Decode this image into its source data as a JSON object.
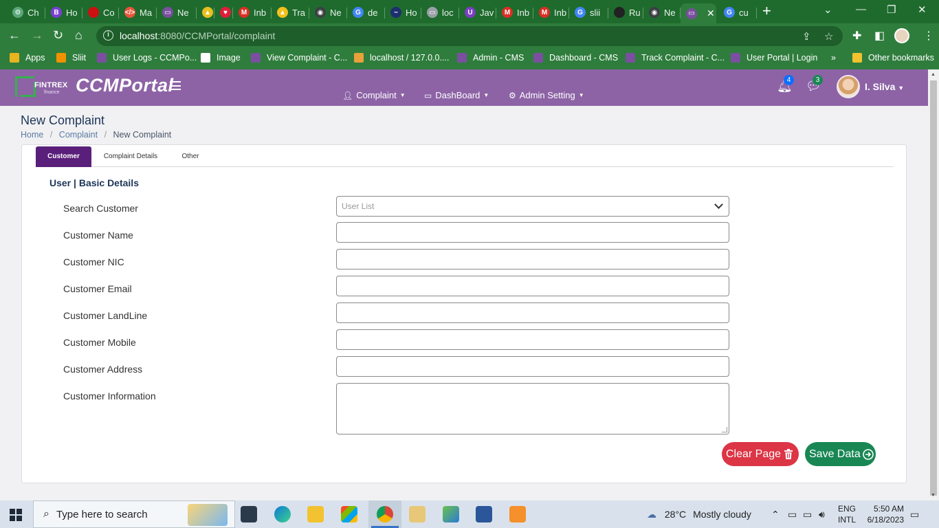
{
  "browser": {
    "tabs": [
      {
        "label": "Ch",
        "color": "#5aa77a",
        "glyph": "⚙"
      },
      {
        "label": "Ho",
        "color": "#7a3fd4",
        "glyph": "B"
      },
      {
        "label": "Co",
        "color": "#cc1111",
        "glyph": ""
      },
      {
        "label": "Ma",
        "color": "#e8553a",
        "glyph": "</>"
      },
      {
        "label": "Ne",
        "color": "#7a4fa0",
        "glyph": "▭"
      },
      {
        "label": "",
        "color": "#e8c01e",
        "glyph": "▲"
      },
      {
        "label": "",
        "color": "#e01e3a",
        "glyph": "♥"
      },
      {
        "label": "Inb",
        "color": "#d93025",
        "glyph": "M"
      },
      {
        "label": "Tra",
        "color": "#f2c01b",
        "glyph": "▲"
      },
      {
        "label": "Ne",
        "color": "#3c4043",
        "glyph": "◉"
      },
      {
        "label": "de",
        "color": "#4285f4",
        "glyph": "G"
      },
      {
        "label": "Ho",
        "color": "#1d2f6f",
        "glyph": "~"
      },
      {
        "label": "loc",
        "color": "#9aa0a6",
        "glyph": "▭"
      },
      {
        "label": "Jav",
        "color": "#7b3fc0",
        "glyph": "U"
      },
      {
        "label": "Inb",
        "color": "#d93025",
        "glyph": "M"
      },
      {
        "label": "Inb",
        "color": "#d93025",
        "glyph": "M"
      },
      {
        "label": "slii",
        "color": "#4285f4",
        "glyph": "G"
      },
      {
        "label": "Ru",
        "color": "#222",
        "glyph": ""
      },
      {
        "label": "Ne",
        "color": "#3c4043",
        "glyph": "◉"
      },
      {
        "label": "",
        "color": "#7a4fa0",
        "glyph": "▭",
        "active": true
      },
      {
        "label": "cu",
        "color": "#4285f4",
        "glyph": "G"
      }
    ],
    "new_tab": "+",
    "url_host": "localhost",
    "url_rest": ":8080/CCMPortal/complaint",
    "bookmarks": [
      {
        "label": "Apps",
        "color": "#e8b51e"
      },
      {
        "label": "Sliit",
        "color": "#f29100"
      },
      {
        "label": "User Logs - CCMPo...",
        "color": "#7a4fa0"
      },
      {
        "label": "Image",
        "color": "#ffffff"
      },
      {
        "label": "View Complaint - C...",
        "color": "#7a4fa0"
      },
      {
        "label": "localhost / 127.0.0....",
        "color": "#e8a13a"
      },
      {
        "label": "Admin - CMS",
        "color": "#7a4fa0"
      },
      {
        "label": "Dashboard - CMS",
        "color": "#7a4fa0"
      },
      {
        "label": "Track Complaint - C...",
        "color": "#7a4fa0"
      },
      {
        "label": "User Portal | Login",
        "color": "#7a4fa0"
      }
    ],
    "bookmarks_more": "»",
    "other_bookmarks": "Other bookmarks"
  },
  "app": {
    "logo_text": "FINTREX",
    "logo_sub": "finance",
    "brand": "CCMPortal",
    "menu": [
      {
        "label": "Complaint",
        "icon": "user-icon"
      },
      {
        "label": "DashBoard",
        "icon": "calendar-icon"
      },
      {
        "label": "Admin Setting",
        "icon": "gear-icon"
      }
    ],
    "notifications_count": "4",
    "messages_count": "3",
    "user_name": "I. Silva"
  },
  "page": {
    "title": "New Complaint",
    "breadcrumb": [
      "Home",
      "Complaint",
      "New Complaint"
    ],
    "tabs": [
      "Customer",
      "Complaint Details",
      "Other"
    ],
    "section_title": "User | Basic Details",
    "fields": [
      {
        "label": "Search Customer",
        "placeholder": "User List",
        "type": "select"
      },
      {
        "label": "Customer Name",
        "placeholder": "",
        "type": "text"
      },
      {
        "label": "Customer NIC",
        "placeholder": "",
        "type": "text"
      },
      {
        "label": "Customer Email",
        "placeholder": "",
        "type": "text"
      },
      {
        "label": "Customer LandLine",
        "placeholder": "",
        "type": "text"
      },
      {
        "label": "Customer Mobile",
        "placeholder": "",
        "type": "text"
      },
      {
        "label": "Customer Address",
        "placeholder": "",
        "type": "text"
      },
      {
        "label": "Customer Information",
        "placeholder": "",
        "type": "textarea"
      }
    ],
    "clear_button": "Clear Page",
    "save_button": "Save Data",
    "colors": {
      "header": "#8d63a6",
      "tab_active": "#5a1f7a",
      "clear": "#dc3545",
      "save": "#198754"
    }
  },
  "taskbar": {
    "search_placeholder": "Type here to search",
    "weather_temp": "28°C",
    "weather_text": "Mostly cloudy",
    "lang_top": "ENG",
    "lang_bottom": "INTL",
    "time": "5:50 AM",
    "date": "6/18/2023"
  }
}
